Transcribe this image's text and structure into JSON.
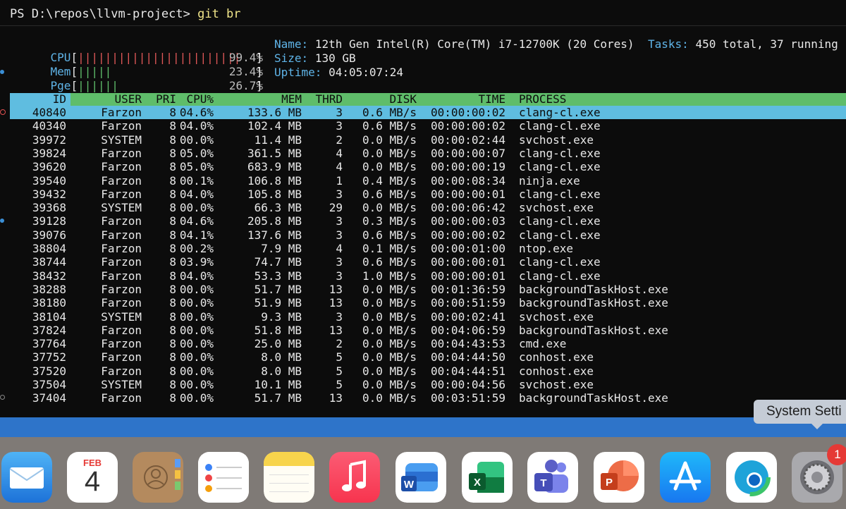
{
  "terminal": {
    "prompt": "PS D:\\repos\\llvm-project> ",
    "command": "git br",
    "meters": [
      {
        "label": "CPU",
        "bar": "||||||||||||||||||||||||",
        "value": "99.4%",
        "color": "#e05858"
      },
      {
        "label": "Mem",
        "bar": "|||||",
        "value": "23.4%",
        "color": "#5fbd6a"
      },
      {
        "label": "Pge",
        "bar": "||||||",
        "value": "26.7%",
        "color": "#5fbd6a"
      }
    ],
    "info": {
      "name_key": "Name:",
      "name_val": "12th Gen Intel(R) Core(TM) i7-12700K (20 Cores)",
      "size_key": "Size:",
      "size_val": "130 GB",
      "uptime_key": "Uptime:",
      "uptime_val": "04:05:07:24",
      "tasks_key": "Tasks:",
      "tasks_val": "450 total, 37 running"
    },
    "columns": {
      "id": "ID",
      "user": "USER",
      "pri": "PRI",
      "cpu": "CPU%",
      "mem": "MEM",
      "thrd": "THRD",
      "disk": "DISK",
      "time": "TIME",
      "process": "PROCESS"
    },
    "rows": [
      {
        "id": "40840",
        "user": "Farzon",
        "pri": "8",
        "cpu": "04.6%",
        "mem": "133.6 MB",
        "thrd": "3",
        "disk": "0.6 MB/s",
        "time": "00:00:00:02",
        "process": "clang-cl.exe"
      },
      {
        "id": "40340",
        "user": "Farzon",
        "pri": "8",
        "cpu": "04.0%",
        "mem": "102.4 MB",
        "thrd": "3",
        "disk": "0.6 MB/s",
        "time": "00:00:00:02",
        "process": "clang-cl.exe"
      },
      {
        "id": "39972",
        "user": "SYSTEM",
        "pri": "8",
        "cpu": "00.0%",
        "mem": "11.4 MB",
        "thrd": "2",
        "disk": "0.0 MB/s",
        "time": "00:00:02:44",
        "process": "svchost.exe"
      },
      {
        "id": "39824",
        "user": "Farzon",
        "pri": "8",
        "cpu": "05.0%",
        "mem": "361.5 MB",
        "thrd": "4",
        "disk": "0.0 MB/s",
        "time": "00:00:00:07",
        "process": "clang-cl.exe"
      },
      {
        "id": "39620",
        "user": "Farzon",
        "pri": "8",
        "cpu": "05.0%",
        "mem": "683.9 MB",
        "thrd": "4",
        "disk": "0.0 MB/s",
        "time": "00:00:00:19",
        "process": "clang-cl.exe"
      },
      {
        "id": "39540",
        "user": "Farzon",
        "pri": "8",
        "cpu": "00.1%",
        "mem": "106.8 MB",
        "thrd": "1",
        "disk": "0.4 MB/s",
        "time": "00:00:08:34",
        "process": "ninja.exe"
      },
      {
        "id": "39432",
        "user": "Farzon",
        "pri": "8",
        "cpu": "04.0%",
        "mem": "105.8 MB",
        "thrd": "3",
        "disk": "0.6 MB/s",
        "time": "00:00:00:01",
        "process": "clang-cl.exe"
      },
      {
        "id": "39368",
        "user": "SYSTEM",
        "pri": "8",
        "cpu": "00.0%",
        "mem": "66.3 MB",
        "thrd": "29",
        "disk": "0.0 MB/s",
        "time": "00:00:06:42",
        "process": "svchost.exe"
      },
      {
        "id": "39128",
        "user": "Farzon",
        "pri": "8",
        "cpu": "04.6%",
        "mem": "205.8 MB",
        "thrd": "3",
        "disk": "0.3 MB/s",
        "time": "00:00:00:03",
        "process": "clang-cl.exe"
      },
      {
        "id": "39076",
        "user": "Farzon",
        "pri": "8",
        "cpu": "04.1%",
        "mem": "137.6 MB",
        "thrd": "3",
        "disk": "0.6 MB/s",
        "time": "00:00:00:02",
        "process": "clang-cl.exe"
      },
      {
        "id": "38804",
        "user": "Farzon",
        "pri": "8",
        "cpu": "00.2%",
        "mem": "7.9 MB",
        "thrd": "4",
        "disk": "0.1 MB/s",
        "time": "00:00:01:00",
        "process": "ntop.exe"
      },
      {
        "id": "38744",
        "user": "Farzon",
        "pri": "8",
        "cpu": "03.9%",
        "mem": "74.7 MB",
        "thrd": "3",
        "disk": "0.6 MB/s",
        "time": "00:00:00:01",
        "process": "clang-cl.exe"
      },
      {
        "id": "38432",
        "user": "Farzon",
        "pri": "8",
        "cpu": "04.0%",
        "mem": "53.3 MB",
        "thrd": "3",
        "disk": "1.0 MB/s",
        "time": "00:00:00:01",
        "process": "clang-cl.exe"
      },
      {
        "id": "38288",
        "user": "Farzon",
        "pri": "8",
        "cpu": "00.0%",
        "mem": "51.7 MB",
        "thrd": "13",
        "disk": "0.0 MB/s",
        "time": "00:01:36:59",
        "process": "backgroundTaskHost.exe"
      },
      {
        "id": "38180",
        "user": "Farzon",
        "pri": "8",
        "cpu": "00.0%",
        "mem": "51.9 MB",
        "thrd": "13",
        "disk": "0.0 MB/s",
        "time": "00:00:51:59",
        "process": "backgroundTaskHost.exe"
      },
      {
        "id": "38104",
        "user": "SYSTEM",
        "pri": "8",
        "cpu": "00.0%",
        "mem": "9.3 MB",
        "thrd": "3",
        "disk": "0.0 MB/s",
        "time": "00:00:02:41",
        "process": "svchost.exe"
      },
      {
        "id": "37824",
        "user": "Farzon",
        "pri": "8",
        "cpu": "00.0%",
        "mem": "51.8 MB",
        "thrd": "13",
        "disk": "0.0 MB/s",
        "time": "00:04:06:59",
        "process": "backgroundTaskHost.exe"
      },
      {
        "id": "37764",
        "user": "Farzon",
        "pri": "8",
        "cpu": "00.0%",
        "mem": "25.0 MB",
        "thrd": "2",
        "disk": "0.0 MB/s",
        "time": "00:04:43:53",
        "process": "cmd.exe"
      },
      {
        "id": "37752",
        "user": "Farzon",
        "pri": "8",
        "cpu": "00.0%",
        "mem": "8.0 MB",
        "thrd": "5",
        "disk": "0.0 MB/s",
        "time": "00:04:44:50",
        "process": "conhost.exe"
      },
      {
        "id": "37520",
        "user": "Farzon",
        "pri": "8",
        "cpu": "00.0%",
        "mem": "8.0 MB",
        "thrd": "5",
        "disk": "0.0 MB/s",
        "time": "00:04:44:51",
        "process": "conhost.exe"
      },
      {
        "id": "37504",
        "user": "SYSTEM",
        "pri": "8",
        "cpu": "00.0%",
        "mem": "10.1 MB",
        "thrd": "5",
        "disk": "0.0 MB/s",
        "time": "00:00:04:56",
        "process": "svchost.exe"
      },
      {
        "id": "37404",
        "user": "Farzon",
        "pri": "8",
        "cpu": "00.0%",
        "mem": "51.7 MB",
        "thrd": "13",
        "disk": "0.0 MB/s",
        "time": "00:03:51:59",
        "process": "backgroundTaskHost.exe"
      }
    ]
  },
  "tooltip": {
    "text": "System Setti"
  },
  "dock": {
    "calendar_month": "FEB",
    "calendar_day": "4",
    "settings_badge": "1",
    "apps": [
      {
        "name": "mail-icon"
      },
      {
        "name": "calendar-icon"
      },
      {
        "name": "contacts-icon"
      },
      {
        "name": "reminders-icon"
      },
      {
        "name": "notes-icon"
      },
      {
        "name": "music-icon"
      },
      {
        "name": "word-icon"
      },
      {
        "name": "excel-icon"
      },
      {
        "name": "teams-icon"
      },
      {
        "name": "powerpoint-icon"
      },
      {
        "name": "app-store-icon"
      },
      {
        "name": "edge-icon"
      },
      {
        "name": "system-settings-icon"
      }
    ],
    "icon_letters": {
      "word": "W",
      "excel": "X",
      "teams": "T",
      "powerpoint": "P"
    }
  },
  "colors": {
    "accent_blue": "#5fb4e8",
    "header_green": "#5fbd6a",
    "selection": "#5fbde0",
    "scrollbar": "#2e74c9"
  }
}
